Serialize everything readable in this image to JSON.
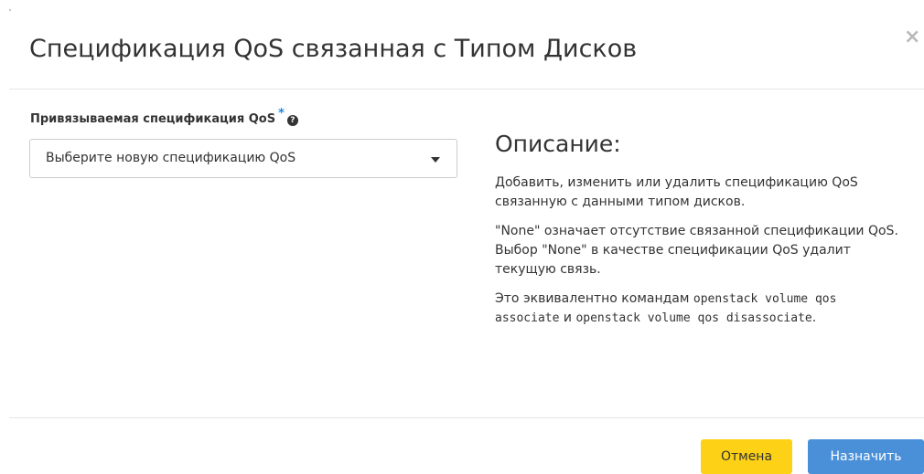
{
  "modal": {
    "title": "Спецификация QoS связанная с Типом Дисков",
    "close_symbol": "×"
  },
  "form": {
    "field_label": "Привязываемая спецификация QoS",
    "required_mark": "*",
    "help_symbol": "?",
    "select_value": "Выберите новую спецификацию QoS"
  },
  "description": {
    "heading": "Описание:",
    "paragraph1": "Добавить, изменить или удалить спецификацию QoS связанную с данными типом дисков.",
    "paragraph2": "\"None\" означает отсутствие связанной спецификации QoS. Выбор \"None\" в качестве спецификации QoS удалит текущую связь.",
    "paragraph3_prefix": "Это эквивалентно командам ",
    "command1": "openstack volume qos associate",
    "paragraph3_conj": " и ",
    "command2": "openstack volume qos disassociate",
    "paragraph3_suffix": "."
  },
  "footer": {
    "cancel_label": "Отмена",
    "submit_label": "Назначить"
  },
  "colors": {
    "cancel_button": "#fcd116",
    "submit_button": "#4a90d9",
    "required_mark": "#1e88e5"
  }
}
